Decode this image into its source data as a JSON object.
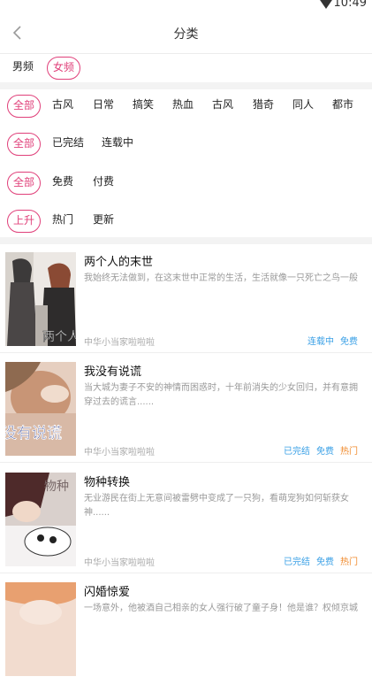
{
  "status": {
    "time": "10:49"
  },
  "nav": {
    "title": "分类"
  },
  "gender": {
    "male": "男频",
    "female": "女频"
  },
  "genre": {
    "items": [
      "全部",
      "古风",
      "日常",
      "搞笑",
      "热血",
      "古风",
      "猎奇",
      "同人",
      "都市"
    ]
  },
  "progress": {
    "items": [
      "全部",
      "已完结",
      "连载中"
    ]
  },
  "price": {
    "items": [
      "全部",
      "免费",
      "付费"
    ]
  },
  "sort": {
    "items": [
      "上升",
      "热门",
      "更新"
    ]
  },
  "colors": {
    "accent": "#e0407a",
    "blue": "#3aa0e6",
    "orange": "#f08a2c"
  },
  "books": [
    {
      "title": "两个人的末世",
      "desc": "我始终无法做到，在这末世中正常的生活，生活就像一只死亡之鸟一般",
      "author": "中华小当家啦啦啦",
      "tags": [
        "连载中",
        "免费"
      ],
      "cover_text": "两个人"
    },
    {
      "title": "我没有说谎",
      "desc": "当大城为妻子不安的神情而困惑时，十年前消失的少女回归，并有意拥穿过去的谎言......",
      "author": "中华小当家啦啦啦",
      "tags": [
        "已完结",
        "免费",
        "热门"
      ],
      "cover_text": "没有说谎"
    },
    {
      "title": "物种转换",
      "desc": "无业游民在街上无意间被雷劈中变成了一只狗，看萌宠狗如何斩获女神......",
      "author": "中华小当家啦啦啦",
      "tags": [
        "已完结",
        "免费",
        "热门"
      ],
      "cover_text": "物种"
    },
    {
      "title": "闪婚惊爱",
      "desc": "一场意外，他被酒自己相亲的女人强行破了童子身！他是谁？权倾京城",
      "author": "",
      "tags": [],
      "cover_text": ""
    }
  ]
}
